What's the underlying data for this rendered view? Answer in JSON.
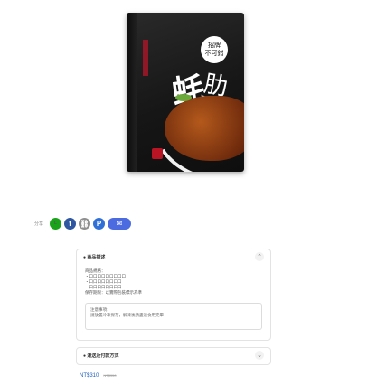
{
  "product": {
    "image_alt": "",
    "box_text_main": "蚝",
    "box_text_side": "肋",
    "badge_lines": [
      "招牌",
      "不可錯"
    ]
  },
  "share": {
    "label": "分享",
    "buttons": [
      {
        "icon": "line-icon",
        "glyph": "L"
      },
      {
        "icon": "facebook-icon",
        "glyph": "f"
      },
      {
        "icon": "link-icon",
        "glyph": "⛓"
      },
      {
        "icon": "plurk-icon",
        "glyph": "P"
      },
      {
        "icon": "mail-icon",
        "glyph": "✉"
      }
    ]
  },
  "description_panel": {
    "title": "● 商品描述",
    "lines": [
      "商品規格：",
      "・口口口口口口口口口",
      "・口口口口口口口口",
      "・口口口口口口口口",
      "保存期限：以實際包裝標示為準"
    ],
    "note_lines": [
      "注意事項：",
      "請放置冷凍保存，解凍後請盡速食用完畢"
    ]
  },
  "shipping_panel": {
    "title": "● 運送及付款方式"
  },
  "price": {
    "current": "NT$310",
    "original": "NT$350"
  }
}
